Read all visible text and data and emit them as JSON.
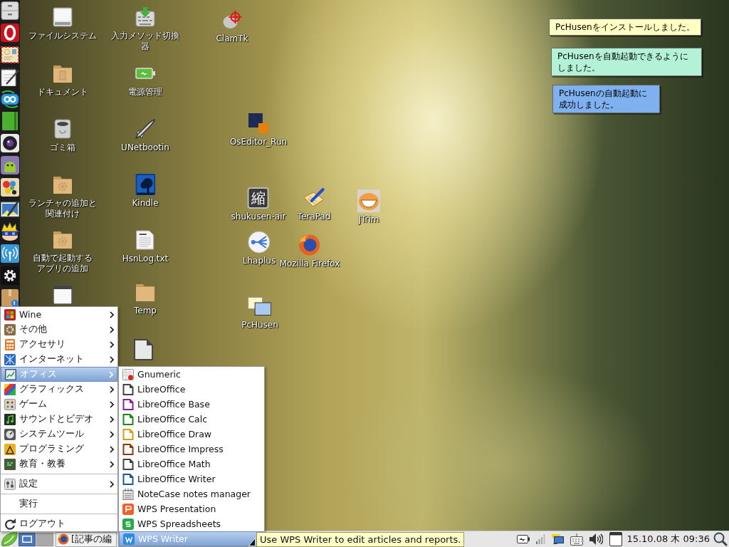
{
  "desktop_icons": [
    {
      "label": "ファイルシステム"
    },
    {
      "label": "ドキュメント"
    },
    {
      "label": "ゴミ箱"
    },
    {
      "label": "ランチャの追加と関連付け"
    },
    {
      "label": "自動で起動するアプリの追加"
    },
    {
      "label": "入力メソッド切換器"
    },
    {
      "label": "電源管理"
    },
    {
      "label": "UNetbootin"
    },
    {
      "label": "Kindle"
    },
    {
      "label": "HsnLog.txt"
    },
    {
      "label": "Temp"
    },
    {
      "label": "ClamTk"
    },
    {
      "label": "OsEditor_Run"
    },
    {
      "label": "shukusen-air",
      "glyph": "縮"
    },
    {
      "label": "TeraPad"
    },
    {
      "label": "JTrim"
    },
    {
      "label": "Lhaplus"
    },
    {
      "label": "Mozilla Firefox"
    },
    {
      "label": "PcHusen"
    }
  ],
  "notifications": [
    {
      "text": "PcHusenをインストールしました。"
    },
    {
      "text": "PcHusenを自動起動できるようにしました。"
    },
    {
      "text": "PcHusenの自動起動に成功しました。"
    }
  ],
  "main_menu": {
    "sections": [
      {
        "items": [
          {
            "label": "Wine",
            "has_submenu": true,
            "selected": false
          },
          {
            "label": "その他",
            "has_submenu": true,
            "selected": false
          },
          {
            "label": "アクセサリ",
            "has_submenu": true,
            "selected": false
          },
          {
            "label": "インターネット",
            "has_submenu": true,
            "selected": false
          },
          {
            "label": "オフィス",
            "has_submenu": true,
            "selected": true
          },
          {
            "label": "グラフィックス",
            "has_submenu": true,
            "selected": false
          },
          {
            "label": "ゲーム",
            "has_submenu": true,
            "selected": false
          },
          {
            "label": "サウンドとビデオ",
            "has_submenu": true,
            "selected": false
          },
          {
            "label": "システムツール",
            "has_submenu": true,
            "selected": false
          },
          {
            "label": "プログラミング",
            "has_submenu": true,
            "selected": false
          },
          {
            "label": "教育・教養",
            "has_submenu": true,
            "selected": false
          }
        ]
      },
      {
        "items": [
          {
            "label": "設定",
            "has_submenu": true,
            "selected": false
          }
        ]
      },
      {
        "items": [
          {
            "label": "実行",
            "has_submenu": false,
            "selected": false
          }
        ]
      },
      {
        "items": [
          {
            "label": "ログアウト",
            "has_submenu": false,
            "selected": false
          }
        ]
      }
    ]
  },
  "submenu": {
    "items": [
      {
        "label": "Gnumeric",
        "selected": false
      },
      {
        "label": "LibreOffice",
        "selected": false
      },
      {
        "label": "LibreOffice Base",
        "selected": false
      },
      {
        "label": "LibreOffice Calc",
        "selected": false
      },
      {
        "label": "LibreOffice Draw",
        "selected": false
      },
      {
        "label": "LibreOffice Impress",
        "selected": false
      },
      {
        "label": "LibreOffice Math",
        "selected": false
      },
      {
        "label": "LibreOffice Writer",
        "selected": false
      },
      {
        "label": "NoteCase notes manager",
        "selected": false
      },
      {
        "label": "WPS Presentation",
        "selected": false
      },
      {
        "label": "WPS Spreadsheets",
        "selected": false
      },
      {
        "label": "WPS Writer",
        "selected": true
      }
    ]
  },
  "tooltip": {
    "text": "Use WPS Writer to edit articles and reports."
  },
  "taskbar": {
    "pager": [
      {
        "selected": true
      },
      {
        "selected": false
      }
    ],
    "task_button": {
      "label": "[記事の編"
    },
    "clock": "15.10.08 木 09:36"
  }
}
